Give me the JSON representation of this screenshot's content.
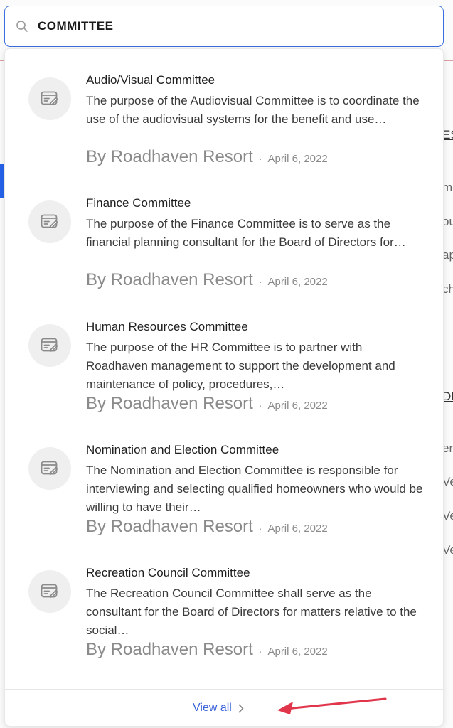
{
  "search": {
    "value": "COMMITTEE",
    "placeholder": ""
  },
  "results": [
    {
      "title": "Audio/Visual Committee",
      "excerpt": "The purpose of the Audiovisual Committee is to coordinate the use of the audiovisual systems for the benefit and use…",
      "author": "By Roadhaven Resort",
      "separator": "·",
      "date": "April 6, 2022",
      "icon": "document-edit-icon"
    },
    {
      "title": "Finance Committee",
      "excerpt": "The purpose of the Finance Committee is to serve as the financial planning consultant for the Board of Directors for…",
      "author": "By Roadhaven Resort",
      "separator": "·",
      "date": "April 6, 2022",
      "icon": "document-edit-icon"
    },
    {
      "title": "Human Resources Committee",
      "excerpt": "The purpose of the HR Committee is to partner with Roadhaven management to support the development and maintenance of policy, procedures,…",
      "author": "By Roadhaven Resort",
      "separator": "·",
      "date": "April 6, 2022",
      "icon": "document-edit-icon"
    },
    {
      "title": "Nomination and Election Committee",
      "excerpt": "The Nomination and Election Committee is responsible for interviewing and selecting qualified homeowners who would be willing to have their…",
      "author": "By Roadhaven Resort",
      "separator": "·",
      "date": "April 6, 2022",
      "icon": "document-edit-icon"
    },
    {
      "title": "Recreation Council Committee",
      "excerpt": "The Recreation Council Committee shall serve as the consultant for the Board of Directors for matters relative to the social…",
      "author": "By Roadhaven Resort",
      "separator": "·",
      "date": "April 6, 2022",
      "icon": "document-edit-icon"
    }
  ],
  "footer": {
    "view_all_label": "View all",
    "chevron_icon": "chevron-right-icon"
  },
  "background_fragments": [
    "ES",
    "me",
    "ou",
    "ap",
    "ch",
    "DI",
    "en",
    "Ve",
    "Ve",
    "Ve"
  ],
  "colors": {
    "accent": "#3b64d9",
    "search_border": "#3b6fe0",
    "annotation_arrow": "#e0354a"
  }
}
